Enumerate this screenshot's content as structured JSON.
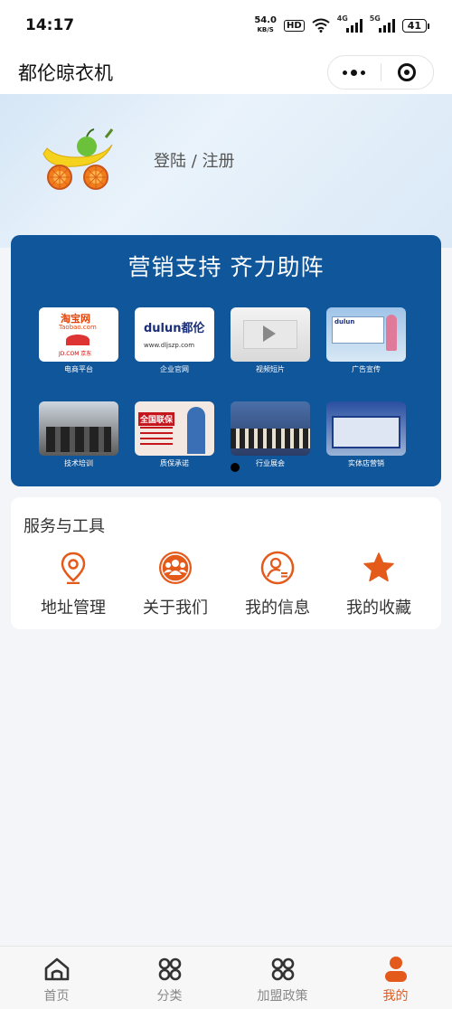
{
  "status_bar": {
    "time": "14:17",
    "speed_value": "54.0",
    "speed_unit": "KB/S",
    "hd": "HD",
    "sig1_tag": "4G",
    "sig2_tag": "5G",
    "battery": "41"
  },
  "title_bar": {
    "title": "都伦晾衣机"
  },
  "profile": {
    "login_label": "登陆 / 注册"
  },
  "banner": {
    "title": "营销支持  齐力助阵",
    "items": [
      {
        "label": "电商平台",
        "thumb_text1": "淘宝网",
        "thumb_text2": "Taobao.com",
        "thumb_text3": "JD.COM 京东"
      },
      {
        "label": "企业官网",
        "thumb_text1": "dulun都伦",
        "thumb_text2": "www.dljszp.com"
      },
      {
        "label": "视频短片"
      },
      {
        "label": "广告宣传",
        "thumb_text1": "dulun"
      },
      {
        "label": "技术培训"
      },
      {
        "label": "质保承诺",
        "thumb_text1": "全国联保"
      },
      {
        "label": "行业展会"
      },
      {
        "label": "实体店营销"
      }
    ]
  },
  "services": {
    "title": "服务与工具",
    "items": [
      {
        "label": "地址管理",
        "icon": "location-icon"
      },
      {
        "label": "关于我们",
        "icon": "group-icon"
      },
      {
        "label": "我的信息",
        "icon": "profile-info-icon"
      },
      {
        "label": "我的收藏",
        "icon": "star-icon"
      }
    ]
  },
  "tabs": [
    {
      "label": "首页",
      "icon": "home-icon"
    },
    {
      "label": "分类",
      "icon": "category-icon"
    },
    {
      "label": "加盟政策",
      "icon": "policy-icon"
    },
    {
      "label": "我的",
      "icon": "user-icon",
      "active": true
    }
  ],
  "colors": {
    "accent": "#e35a1b",
    "banner_bg": "#10569b"
  }
}
